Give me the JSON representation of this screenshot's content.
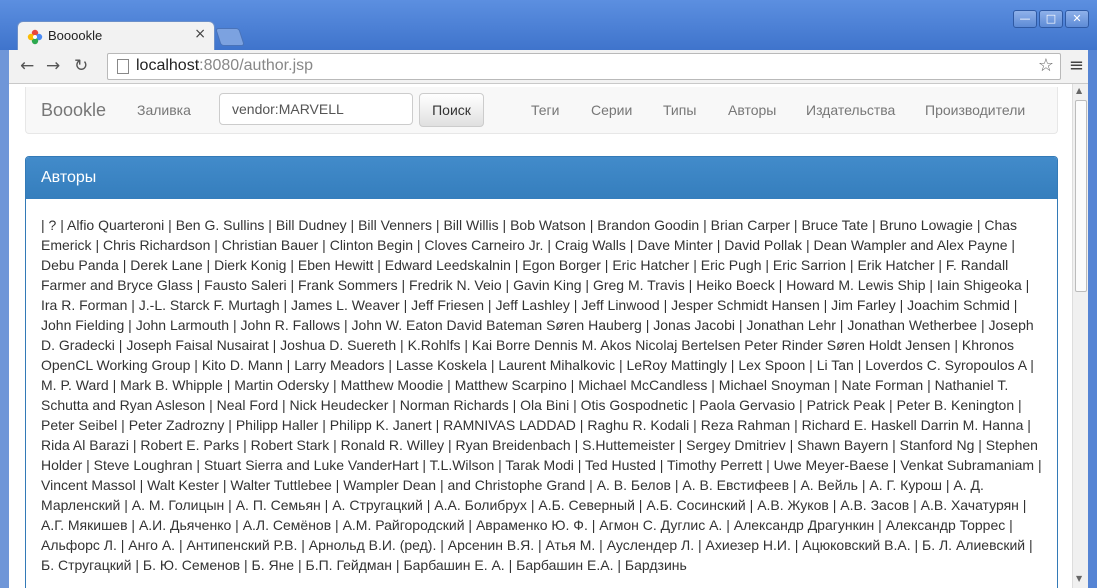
{
  "browser": {
    "tab_title": "Booookle",
    "tab_close": "×",
    "url_host": "localhost",
    "url_rest": ":8080/author.jsp",
    "back": "←",
    "forward": "→",
    "reload": "↻",
    "star": "☆",
    "menu": "≡",
    "win_min": "—",
    "win_max": "□",
    "win_close": "✕"
  },
  "navbar": {
    "brand": "Boookle",
    "upload": "Заливка",
    "search_value": "vendor:MARVELL",
    "search_button": "Поиск",
    "links": [
      "Теги",
      "Серии",
      "Типы",
      "Авторы",
      "Издательства",
      "Производители"
    ]
  },
  "panel": {
    "title": "Авторы",
    "authors": [
      "?",
      "Alfio Quarteroni",
      "Ben G. Sullins",
      "Bill Dudney",
      "Bill Venners",
      "Bill Willis",
      "Bob Watson",
      "Brandon Goodin",
      "Brian Carper",
      "Bruce Tate",
      "Bruno Lowagie",
      "Chas Emerick",
      "Chris Richardson",
      "Christian Bauer",
      "Clinton Begin",
      "Cloves Carneiro Jr.",
      "Craig Walls",
      "Dave Minter",
      "David Pollak",
      "Dean Wampler and Alex Payne",
      "Debu Panda",
      "Derek Lane",
      "Dierk Konig",
      "Eben Hewitt",
      "Edward Leedskalnin",
      "Egon Borger",
      "Eric Hatcher",
      "Eric Pugh",
      "Eric Sarrion",
      "Erik Hatcher",
      "F. Randall Farmer and Bryce Glass",
      "Fausto Saleri",
      "Frank Sommers",
      "Fredrik N. Veio",
      "Gavin King",
      "Greg M. Travis",
      "Heiko Boeck",
      "Howard M. Lewis Ship",
      "Iain Shigeoka",
      "Ira R. Forman",
      "J.-L. Starck F. Murtagh",
      "James L. Weaver",
      "Jeff Friesen",
      "Jeff Lashley",
      "Jeff Linwood",
      "Jesper Schmidt Hansen",
      "Jim Farley",
      "Joachim Schmid",
      "John Fielding",
      "John Larmouth",
      "John R. Fallows",
      "John W. Eaton David Bateman Søren Hauberg",
      "Jonas Jacobi",
      "Jonathan Lehr",
      "Jonathan Wetherbee",
      "Joseph D. Gradecki",
      "Joseph Faisal Nusairat",
      "Joshua D. Suereth",
      "K.Rohlfs",
      "Kai Borre Dennis M. Akos Nicolaj Bertelsen Peter Rinder Søren Holdt Jensen",
      "Khronos OpenCL Working Group",
      "Kito D. Mann",
      "Larry Meadors",
      "Lasse Koskela",
      "Laurent Mihalkovic",
      "LeRoy Mattingly",
      "Lex Spoon",
      "Li Tan",
      "Loverdos C. Syropoulos A",
      "M. P. Ward",
      "Mark B. Whipple",
      "Martin Odersky",
      "Matthew Moodie",
      "Matthew Scarpino",
      "Michael McCandless",
      "Michael Snoyman",
      "Nate Forman",
      "Nathaniel T. Schutta and Ryan Asleson",
      "Neal Ford",
      "Nick Heudecker",
      "Norman Richards",
      "Ola Bini",
      "Otis Gospodnetic",
      "Paola Gervasio",
      "Patrick Peak",
      "Peter B. Kenington",
      "Peter Seibel",
      "Peter Zadrozny",
      "Philipp Haller",
      "Philipp K. Janert",
      "RAMNIVAS LADDAD",
      "Raghu R. Kodali",
      "Reza Rahman",
      "Richard E. Haskell Darrin M. Hanna",
      "Rida Al Barazi",
      "Robert E. Parks",
      "Robert Stark",
      "Ronald R. Willey",
      "Ryan Breidenbach",
      "S.Huttemeister",
      "Sergey Dmitriev",
      "Shawn Bayern",
      "Stanford Ng",
      "Stephen Holder",
      "Steve Loughran",
      "Stuart Sierra and Luke VanderHart",
      "T.L.Wilson",
      "Tarak Modi",
      "Ted Husted",
      "Timothy Perrett",
      "Uwe Meyer-Baese",
      "Venkat Subramaniam",
      "Vincent Massol",
      "Walt Kester",
      "Walter Tuttlebee",
      "Wampler Dean",
      "and Christophe Grand",
      "А. В. Белов",
      "А. В. Евстифеев",
      "А. Вейль",
      "А. Г. Курош",
      "А. Д. Марленский",
      "А. М. Голицын",
      "А. П. Семьян",
      "А. Стругацкий",
      "А.А. Болибрух",
      "А.Б. Северный",
      "А.Б. Сосинский",
      "А.В. Жуков",
      "А.В. Засов",
      "А.В. Хачатурян",
      "А.Г. Мякишев",
      "А.И. Дьяченко",
      "А.Л. Семёнов",
      "А.М. Райгородский",
      "Авраменко Ю. Ф.",
      "Агмон С. Дуглис А.",
      "Александр Драгункин",
      "Александр Торрес",
      "Альфорс Л.",
      "Анго А.",
      "Антипенский Р.В.",
      "Арнольд В.И. (ред).",
      "Арсенин В.Я.",
      "Атья М.",
      "Ауслендер Л.",
      "Ахиезер Н.И.",
      "Ацюковский В.А.",
      "Б. Л. Алиевский",
      "Б. Стругацкий",
      "Б. Ю. Семенов",
      "Б. Яне",
      "Б.П. Гейдман",
      "Барбашин Е. А.",
      "Барбашин Е.А.",
      "Бардзинь"
    ]
  }
}
